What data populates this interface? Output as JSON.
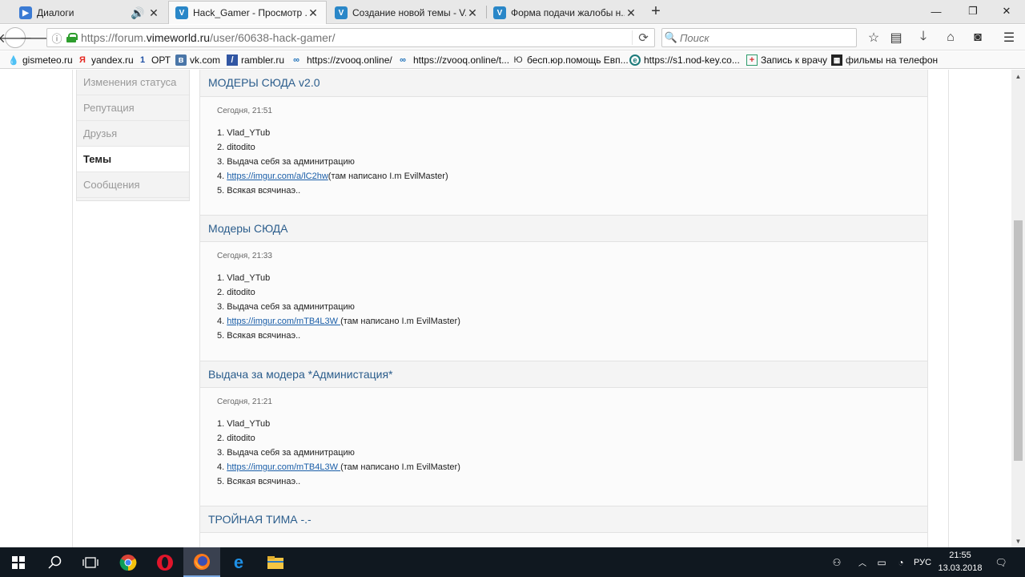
{
  "browser": {
    "tabs": [
      {
        "title": "Диалоги",
        "icon": "dialogs-icon",
        "audio": true,
        "active": false
      },
      {
        "title": "Hack_Gamer - Просмотр ...",
        "icon": "vimeworld-icon",
        "active": true
      },
      {
        "title": "Создание новой темы - V...",
        "icon": "vimeworld-icon",
        "active": false
      },
      {
        "title": "Форма подачи жалобы н...",
        "icon": "vimeworld-icon",
        "active": false
      }
    ],
    "url_prefix": "https://forum.",
    "url_host": "vimeworld.ru",
    "url_path": "/user/60638-hack-gamer/",
    "search_placeholder": "Поиск",
    "bookmarks": [
      {
        "label": "gismeteo.ru",
        "icon": "gismeteo-icon"
      },
      {
        "label": "yandex.ru",
        "icon": "yandex-icon"
      },
      {
        "label": "ОРТ",
        "icon": "ort-icon"
      },
      {
        "label": "vk.com",
        "icon": "vk-icon"
      },
      {
        "label": "rambler.ru",
        "icon": "rambler-icon"
      },
      {
        "label": "https://zvooq.online/",
        "icon": "zvooq-icon"
      },
      {
        "label": "https://zvooq.online/t...",
        "icon": "zvooq-icon"
      },
      {
        "label": "бесп.юр.помощь Евп...",
        "icon": "law-icon"
      },
      {
        "label": "https://s1.nod-key.co...",
        "icon": "nod-icon"
      },
      {
        "label": "Запись к врачу",
        "icon": "doctor-icon"
      },
      {
        "label": "фильмы на телефон",
        "icon": "film-icon"
      }
    ]
  },
  "sidebar": {
    "items": [
      {
        "label": "Изменения статуса",
        "active": false
      },
      {
        "label": "Репутация",
        "active": false
      },
      {
        "label": "Друзья",
        "active": false
      },
      {
        "label": "Темы",
        "active": true
      },
      {
        "label": "Сообщения",
        "active": false
      }
    ]
  },
  "topics": [
    {
      "title": "МОДЕРЫ СЮДА v2.0",
      "date": "Сегодня, 21:51",
      "lines": {
        "l1": "1. Vlad_YTub",
        "l2": "2. ditodito",
        "l3": "3. Выдача себя за админитрацию",
        "l4_prefix": "4. ",
        "l4_link": "https://imgur.com/a/lC2hw",
        "l4_suffix": "(там написано I.m EvilMaster)",
        "l5": "5. Всякая всячинаэ.."
      }
    },
    {
      "title": "Модеры СЮДА",
      "date": "Сегодня, 21:33",
      "lines": {
        "l1": "1. Vlad_YTub",
        "l2": "2. ditodito",
        "l3": "3. Выдача себя за админитрацию",
        "l4_prefix": "4. ",
        "l4_link": "https://imgur.com/mTB4L3W ",
        "l4_suffix": "(там написано I.m EvilMaster)",
        "l5": "5. Всякая всячинаэ.."
      }
    },
    {
      "title": "Выдача за модера *Администация*",
      "date": "Сегодня, 21:21",
      "lines": {
        "l1": "1. Vlad_YTub",
        "l2": "2. ditodito",
        "l3": "3. Выдача себя за админитрацию",
        "l4_prefix": "4. ",
        "l4_link": "https://imgur.com/mTB4L3W ",
        "l4_suffix": "(там написано I.m EvilMaster)",
        "l5": "5. Всякая всячинаэ.."
      }
    },
    {
      "title": "ТРОЙНАЯ ТИМА -.-"
    }
  ],
  "taskbar": {
    "lang": "РУС",
    "time": "21:55",
    "date": "13.03.2018"
  }
}
